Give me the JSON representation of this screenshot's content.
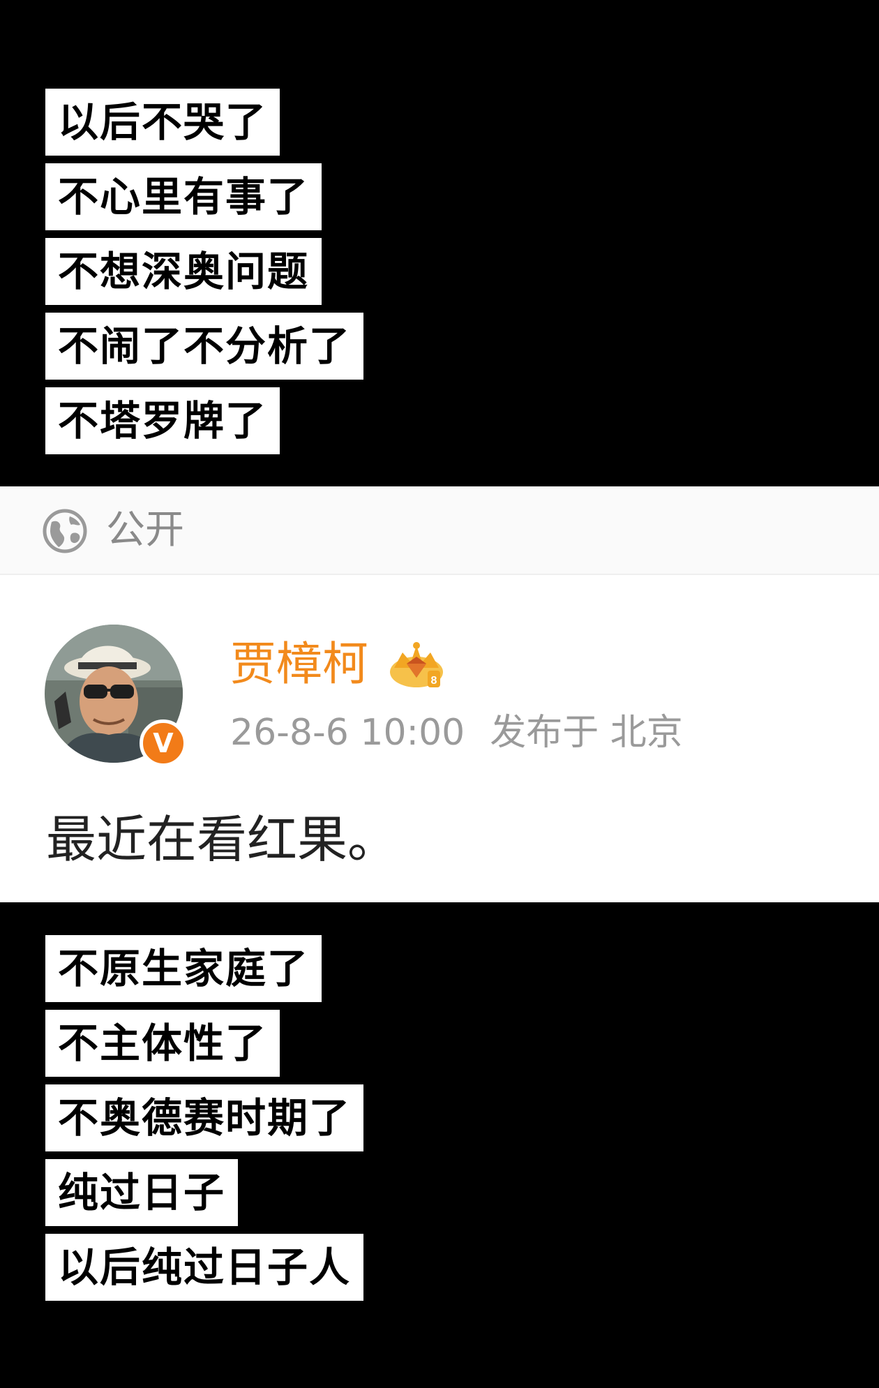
{
  "top_captions": [
    "以后不哭了",
    "不心里有事了",
    "不想深奥问题",
    "不闹了不分析了",
    "不塔罗牌了"
  ],
  "post": {
    "visibility_icon": "globe-icon",
    "visibility_label": "公开",
    "author": {
      "name": "贾樟柯",
      "verified_badge": "V",
      "member_icon": "crown-badge-icon"
    },
    "timestamp": "26-8-6 10:00",
    "location": "发布于 北京",
    "text": "最近在看红果。"
  },
  "bottom_captions": [
    "不原生家庭了",
    "不主体性了",
    "不奥德赛时期了",
    "纯过日子",
    "以后纯过日子人"
  ],
  "colors": {
    "username": "#f28a1c",
    "verified_badge": "#f27b18",
    "meta_text": "#9a9a9a",
    "caption_bg": "#ffffff",
    "page_bg": "#000000"
  }
}
